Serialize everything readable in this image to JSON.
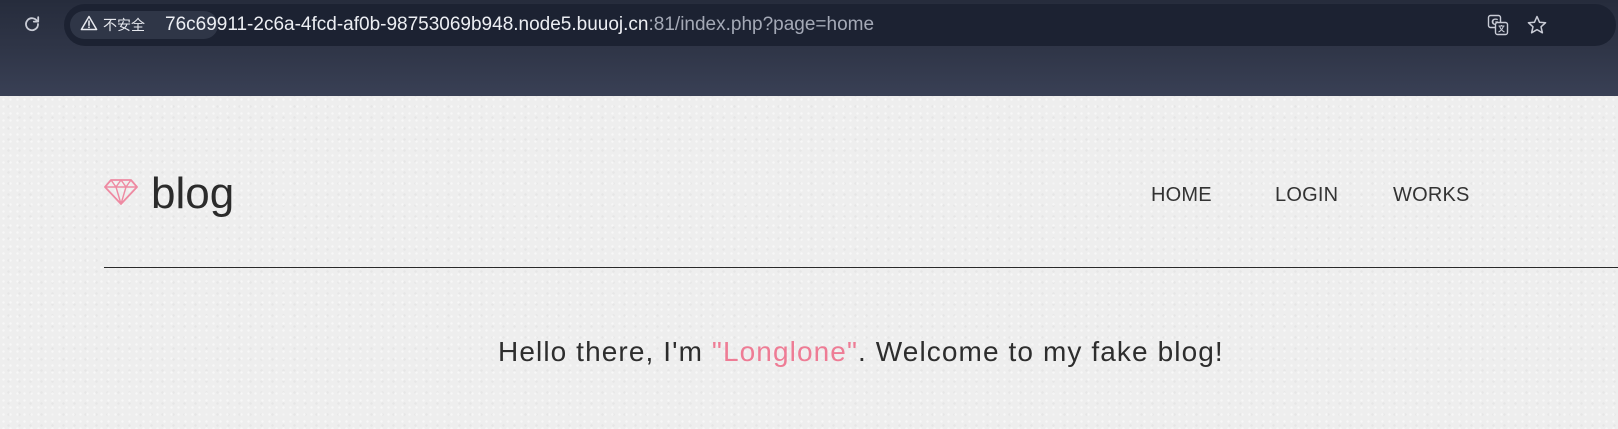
{
  "browser": {
    "security_label": "不安全",
    "url_main": "76c69911-2c6a-4fcd-af0b-98753069b948.node5.buuoj.cn",
    "url_rest": ":81/index.php?page=home"
  },
  "site": {
    "logo_text": "blog",
    "accent_color": "#ee7c95",
    "nav": [
      {
        "label": "HOME"
      },
      {
        "label": "LOGIN"
      },
      {
        "label": "WORKS"
      }
    ],
    "greeting": {
      "prefix": "Hello there, I'm ",
      "name": "\"Longlone\"",
      "suffix": ". Welcome to my fake blog!"
    }
  }
}
